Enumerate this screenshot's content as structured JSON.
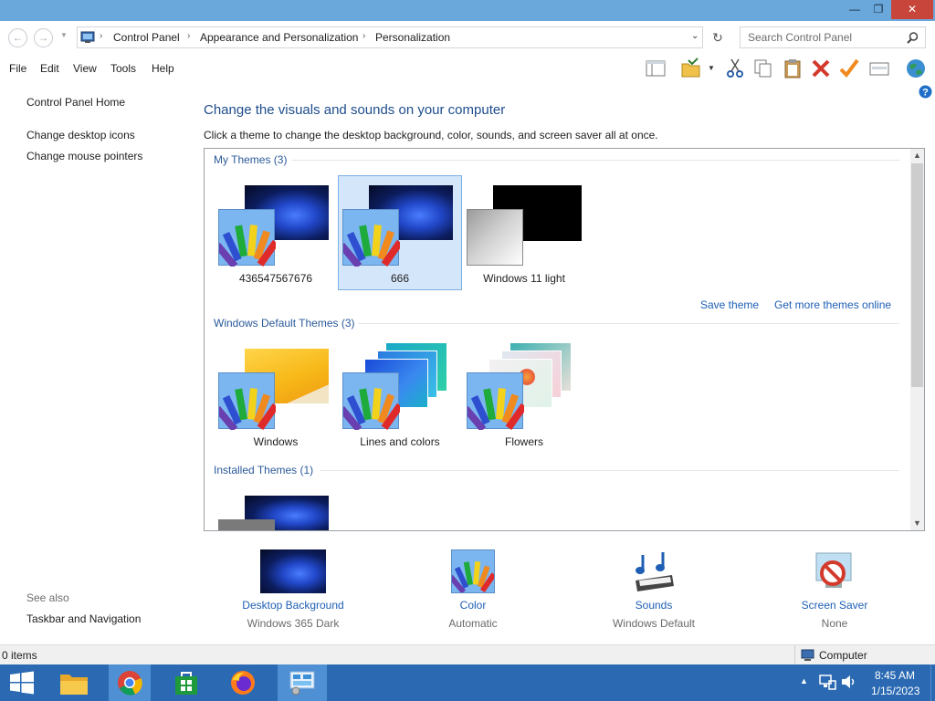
{
  "window": {
    "minimize_glyph": "—",
    "restore_glyph": "❐",
    "close_glyph": "✕"
  },
  "address": {
    "crumbs": [
      "Control Panel",
      "Appearance and Personalization",
      "Personalization"
    ],
    "search_placeholder": "Search Control Panel"
  },
  "menu": [
    "File",
    "Edit",
    "View",
    "Tools",
    "Help"
  ],
  "left_pane": {
    "home": "Control Panel Home",
    "links": [
      "Change desktop icons",
      "Change mouse pointers"
    ],
    "see_also_title": "See also",
    "see_also": [
      "Taskbar and Navigation"
    ]
  },
  "main": {
    "heading": "Change the visuals and sounds on your computer",
    "description": "Click a theme to change the desktop background, color, sounds, and screen saver all at once.",
    "groups": {
      "my_themes": "My Themes (3)",
      "default_themes": "Windows Default Themes (3)",
      "installed_themes": "Installed Themes (1)"
    },
    "my_themes": [
      {
        "name": "436547567676",
        "selected": false
      },
      {
        "name": "666",
        "selected": true
      },
      {
        "name": "Windows 11 light",
        "selected": false
      }
    ],
    "default_themes": [
      {
        "name": "Windows"
      },
      {
        "name": "Lines and colors"
      },
      {
        "name": "Flowers"
      }
    ],
    "save_theme": "Save theme",
    "get_more": "Get more themes online"
  },
  "bottom": {
    "background": {
      "label": "Desktop Background",
      "value": "Windows 365 Dark"
    },
    "color": {
      "label": "Color",
      "value": "Automatic"
    },
    "sounds": {
      "label": "Sounds",
      "value": "Windows Default"
    },
    "screensaver": {
      "label": "Screen Saver",
      "value": "None"
    }
  },
  "status": {
    "items": "0 items",
    "location": "Computer"
  },
  "taskbar": {
    "time": "8:45 AM",
    "date": "1/15/2023"
  },
  "colors": {
    "titlebar": "#6aa8dc",
    "link": "#1e5fb4",
    "heading": "#1e4d8c",
    "taskbar": "#2b6ab3",
    "selected_tile": "#d4e6fa"
  }
}
